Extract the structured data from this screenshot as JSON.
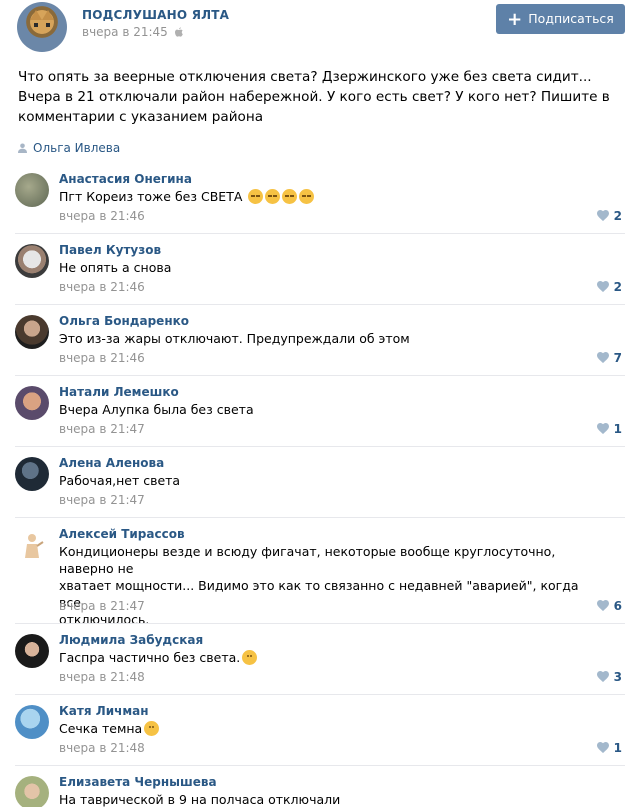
{
  "group": {
    "name": "ПОДСЛУШАНО ЯЛТА",
    "time": "вчера в 21:45",
    "subscribe_label": "Подписаться"
  },
  "post": {
    "text": "Что опять за веерные отключения света? Дзержинского уже без света сидит...\nВчера в 21 отключали район набережной. У кого есть свет? У кого нет? Пишите в\nкомментарии с указанием района",
    "author": "Ольга Ивлева"
  },
  "comments": [
    {
      "author": "Анастасия Онегина",
      "text": "Пгт Кореиз тоже без СВЕТА",
      "emoji": "pensive-x4",
      "time": "вчера в 21:46",
      "likes": "2"
    },
    {
      "author": "Павел Кутузов",
      "text": "Не опять а снова",
      "time": "вчера в 21:46",
      "likes": "2"
    },
    {
      "author": "Ольга Бондаренко",
      "text": "Это из-за жары отключают. Предупреждали об этом",
      "time": "вчера в 21:46",
      "likes": "7"
    },
    {
      "author": "Натали Лемешко",
      "text": "Вчера Алупка была без света",
      "time": "вчера в 21:47",
      "likes": "1"
    },
    {
      "author": "Алена Аленова",
      "text": "Рабочая,нет света",
      "time": "вчера в 21:47",
      "likes": ""
    },
    {
      "author": "Алексей Тирассов",
      "text": "Кондиционеры везде и всюду фигачат, некоторые вообще круглосуточно, наверно не\nхватает мощности... Видимо это как то связанно с недавней \"аварией\", когда все\nотключилось.",
      "time": "вчера в 21:47",
      "likes": "6"
    },
    {
      "author": "Людмила Забудская",
      "text": "Гаспра частично без света.",
      "emoji": "neutral",
      "time": "вчера в 21:48",
      "likes": "3"
    },
    {
      "author": "Катя Личман",
      "text": "Сечка темна",
      "emoji": "neutral",
      "time": "вчера в 21:48",
      "likes": "1"
    },
    {
      "author": "Елизавета Чернышева",
      "text": "На таврической в 9 на полчаса отключали",
      "time": "",
      "likes": ""
    }
  ],
  "icons": {
    "apple": "apple-icon",
    "plus": "plus-icon",
    "person": "person-icon",
    "heart": "heart-icon"
  },
  "colors": {
    "link": "#2a5885",
    "button": "#5e81a8",
    "muted": "#939393",
    "like_heart": "#a3b8cc",
    "divider": "#e7e8ec"
  }
}
